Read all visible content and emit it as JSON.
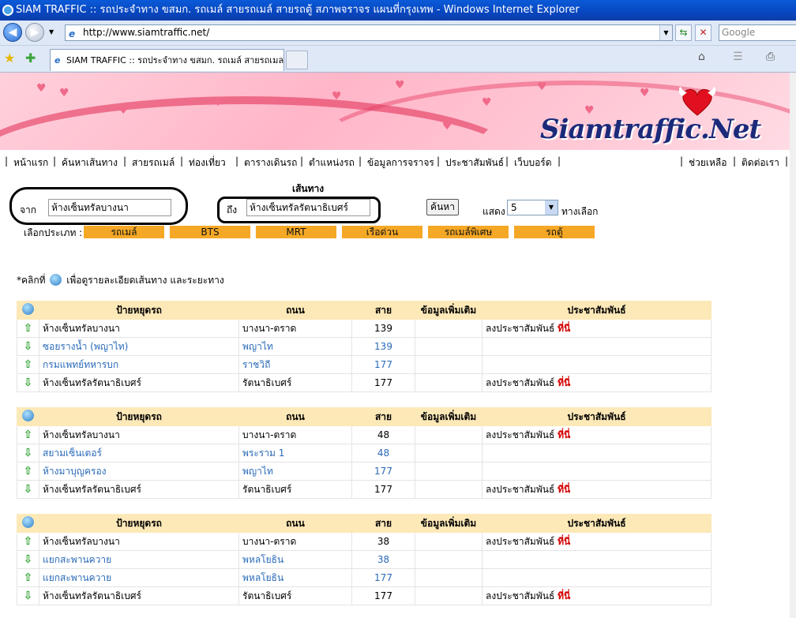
{
  "window": {
    "title": "SIAM TRAFFIC :: รถประจำทาง ขสมก. รถเมล์ สายรถเมล์ สายรถตู้ สภาพจราจร แผนที่กรุงเทพ - Windows Internet Explorer"
  },
  "browser": {
    "url": "http://www.siamtraffic.net/",
    "search_placeholder": "Google",
    "tab_title": "SIAM TRAFFIC :: รถประจำทาง ขสมก. รถเมล์ สายรถเมล..."
  },
  "logo": {
    "text": "Siamtraffic.Net"
  },
  "menu": {
    "items": [
      "หน้าแรก",
      "ค้นหาเส้นทาง",
      "สายรถเมล์",
      "ท่องเที่ยว",
      "ตารางเดินรถ",
      "ตำแหน่งรถ",
      "ข้อมูลการจราจร",
      "ประชาสัมพันธ์",
      "เว็บบอร์ด"
    ],
    "right": [
      "ช่วยเหลือ",
      "ติดต่อเรา"
    ]
  },
  "search": {
    "title": "เส้นทาง",
    "from_label": "จาก",
    "from_value": "ห้างเซ็นทรัลบางนา",
    "to_label": "ถึง",
    "to_value": "ห้างเซ็นทรัลรัตนาธิเบศร์",
    "button": "ค้นหา",
    "show_label": "แสดง",
    "show_value": "5",
    "options_label": "ทางเลือก",
    "type_label": "เลือกประเภท :",
    "types": [
      "รถเมล์",
      "BTS",
      "MRT",
      "เรือด่วน",
      "รถเมล์พิเศษ",
      "รถตู้"
    ]
  },
  "note": {
    "prefix": "*คลิกที่",
    "suffix": "เพื่อดูรายละเอียดเส้นทาง และระยะทาง"
  },
  "table_headers": {
    "stop": "ป้ายหยุดรถ",
    "road": "ถนน",
    "line": "สาย",
    "info": "ข้อมูลเพิ่มเติม",
    "pr": "ประชาสัมพันธ์"
  },
  "pr_text": "ลงประชาสัมพันธ์",
  "pr_link": "ที่นี่",
  "routes": [
    {
      "rows": [
        {
          "dir": "up",
          "stop": "ห้างเซ็นทรัลบางนา",
          "road": "บางนา-ตราด",
          "line": "139",
          "pr": true,
          "link": false
        },
        {
          "dir": "down",
          "stop": "ซอยรางน้ำ (พญาไท)",
          "road": "พญาไท",
          "line": "139",
          "pr": false,
          "link": true
        },
        {
          "dir": "up",
          "stop": "กรมแพทย์ทหารบก",
          "road": "ราชวิถี",
          "line": "177",
          "pr": false,
          "link": true
        },
        {
          "dir": "down",
          "stop": "ห้างเซ็นทรัลรัตนาธิเบศร์",
          "road": "รัตนาธิเบศร์",
          "line": "177",
          "pr": true,
          "link": false
        }
      ]
    },
    {
      "rows": [
        {
          "dir": "up",
          "stop": "ห้างเซ็นทรัลบางนา",
          "road": "บางนา-ตราด",
          "line": "48",
          "pr": true,
          "link": false
        },
        {
          "dir": "down",
          "stop": "สยามเซ็นเตอร์",
          "road": "พระราม 1",
          "line": "48",
          "pr": false,
          "link": true
        },
        {
          "dir": "up",
          "stop": "ห้างมาบุญครอง",
          "road": "พญาไท",
          "line": "177",
          "pr": false,
          "link": true
        },
        {
          "dir": "down",
          "stop": "ห้างเซ็นทรัลรัตนาธิเบศร์",
          "road": "รัตนาธิเบศร์",
          "line": "177",
          "pr": true,
          "link": false
        }
      ]
    },
    {
      "rows": [
        {
          "dir": "up",
          "stop": "ห้างเซ็นทรัลบางนา",
          "road": "บางนา-ตราด",
          "line": "38",
          "pr": true,
          "link": false
        },
        {
          "dir": "down",
          "stop": "แยกสะพานควาย",
          "road": "พหลโยธิน",
          "line": "38",
          "pr": false,
          "link": true
        },
        {
          "dir": "up",
          "stop": "แยกสะพานควาย",
          "road": "พหลโยธิน",
          "line": "177",
          "pr": false,
          "link": true
        },
        {
          "dir": "down",
          "stop": "ห้างเซ็นทรัลรัตนาธิเบศร์",
          "road": "รัตนาธิเบศร์",
          "line": "177",
          "pr": true,
          "link": false
        }
      ]
    }
  ]
}
